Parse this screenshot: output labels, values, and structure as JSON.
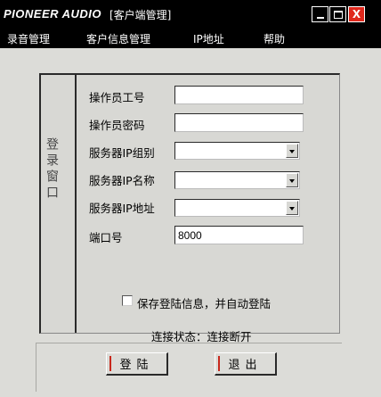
{
  "titlebar": {
    "app_name": "PIONEER AUDIO",
    "title": "[客户端管理]",
    "min_symbol": "_",
    "close_symbol": "X"
  },
  "menu": {
    "items": [
      {
        "label": "录音管理"
      },
      {
        "label": "客户信息管理"
      },
      {
        "label": "IP地址"
      },
      {
        "label": "帮助"
      }
    ]
  },
  "login_panel": {
    "side_label": "登录窗口",
    "fields": {
      "operator_id": {
        "label": "操作员工号",
        "value": ""
      },
      "operator_password": {
        "label": "操作员密码",
        "value": ""
      },
      "server_ip_group": {
        "label": "服务器IP组别",
        "value": ""
      },
      "server_ip_name": {
        "label": "服务器IP名称",
        "value": ""
      },
      "server_ip_address": {
        "label": "服务器IP地址",
        "value": ""
      },
      "port": {
        "label": "端口号",
        "value": "8000"
      }
    },
    "auto_login": {
      "label": "保存登陆信息，并自动登陆",
      "checked": false
    },
    "status": {
      "text": "连接状态：连接断开"
    }
  },
  "buttons": {
    "login_label": "登陆",
    "exit_label": "退出"
  },
  "colors": {
    "titlebar_bg": "#000000",
    "close_button": "#e0281c",
    "window_bg": "#dcdcd8"
  }
}
